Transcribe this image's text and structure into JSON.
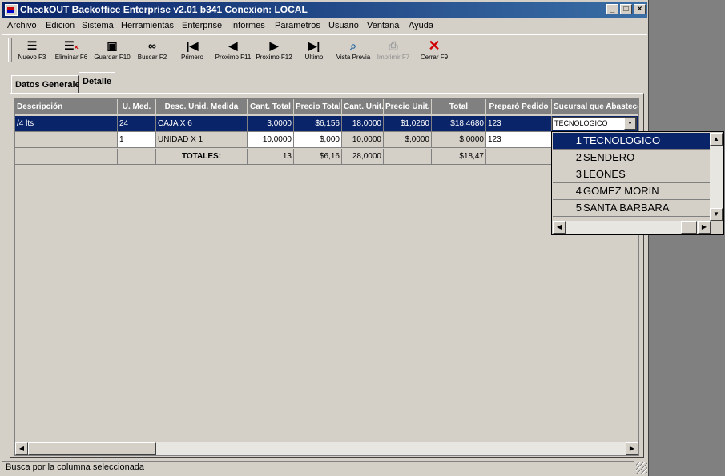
{
  "window": {
    "title": "CheckOUT Backoffice Enterprise v2.01 b341 Conexion: LOCAL"
  },
  "menu": [
    "Archivo",
    "Edicion",
    "Sistema",
    "Herramientas",
    "Enterprise",
    "Informes",
    "Parametros",
    "Usuario",
    "Ventana",
    "Ayuda"
  ],
  "toolbar": {
    "nuevo": "Nuevo F3",
    "eliminar": "Eliminar F6",
    "guardar": "Guardar F10",
    "buscar": "Buscar F2",
    "primero": "Primero",
    "prox_anterior": "Proximo F11",
    "prox_siguiente": "Proximo F12",
    "ultimo": "Ultimo",
    "vista": "Vista Previa",
    "imprimir": "Imprimir F7",
    "cerrar": "Cerrar F9"
  },
  "tabs": [
    "Datos Generales",
    "Detalle"
  ],
  "grid": {
    "headers": [
      "Descripción",
      "U. Med.",
      "Desc. Unid. Medida",
      "Cant. Total",
      "Precio Total",
      "Cant. Unit.",
      "Precio Unit.",
      "Total",
      "Preparó Pedido",
      "Sucursal que Abastece"
    ],
    "rows": [
      [
        "/4 lts",
        "24",
        "CAJA X 6",
        "3,0000",
        "$6,156",
        "18,0000",
        "$1,0260",
        "$18,4680",
        "123",
        "TECNOLOGICO"
      ],
      [
        "",
        "1",
        "UNIDAD X 1",
        "10,0000",
        "$,000",
        "10,0000",
        "$,0000",
        "$,0000",
        "123",
        ""
      ]
    ],
    "totals": [
      "",
      "",
      "TOTALES:",
      "13",
      "$6,16",
      "28,0000",
      "",
      "$18,47",
      "",
      ""
    ]
  },
  "dropdown": [
    {
      "num": "1",
      "name": "TECNOLOGICO"
    },
    {
      "num": "2",
      "name": "SENDERO"
    },
    {
      "num": "3",
      "name": "LEONES"
    },
    {
      "num": "4",
      "name": "GOMEZ MORIN"
    },
    {
      "num": "5",
      "name": "SANTA BARBARA"
    }
  ],
  "status": "Busca por la columna seleccionada"
}
